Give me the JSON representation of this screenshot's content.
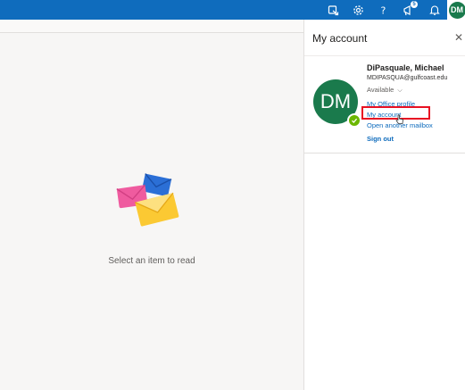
{
  "header": {
    "icons": [
      "meet-now-icon",
      "settings-icon",
      "help-icon",
      "announcement-icon",
      "bell-icon"
    ],
    "notification_count": "5",
    "avatar_initials": "DM"
  },
  "reading_pane": {
    "empty_message": "Select an item to read"
  },
  "account_panel": {
    "title": "My account",
    "close_glyph": "✕",
    "user": {
      "name": "DiPasquale, Michael",
      "email": "MDIPASQUA@gulfcoast.edu",
      "initials": "DM",
      "status": "Available",
      "presence_color": "#6bb700",
      "avatar_color": "#1a7a4c"
    },
    "links": {
      "office_profile": "My Office profile",
      "my_account": "My account",
      "open_mailbox": "Open another mailbox",
      "sign_out": "Sign out"
    }
  },
  "colors": {
    "brand": "#0f6cbd",
    "highlight": "#e81123"
  }
}
